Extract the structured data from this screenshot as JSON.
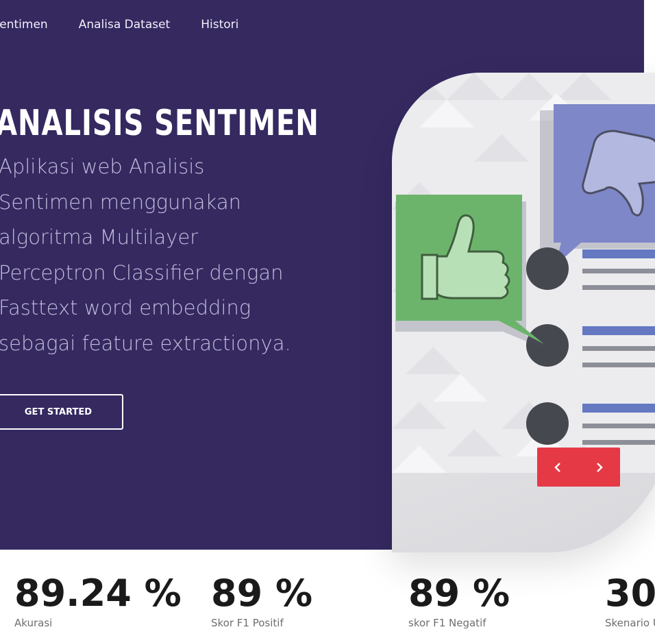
{
  "nav": {
    "items": [
      "limat Sentimen",
      "Analisa Dataset",
      "Histori"
    ]
  },
  "hero": {
    "title": "ANALISIS SENTIMEN",
    "description": "Aplikasi web Analisis Sentimen menggunakan algoritma Multilayer Perceptron Classifier dengan Fasttext word embedding sebagai feature extractionya.",
    "cta_label": "GET STARTED"
  },
  "carousel": {
    "prev_icon": "chevron-left-icon",
    "next_icon": "chevron-right-icon"
  },
  "stats": [
    {
      "value": "89.24 %",
      "label": "Akurasi"
    },
    {
      "value": "89 %",
      "label": "Skor F1 Positif"
    },
    {
      "value": "89 %",
      "label": "skor F1 Negatif"
    },
    {
      "value": "30",
      "label": "Skenario U"
    }
  ],
  "colors": {
    "hero_bg": "#352960",
    "accent": "#e53946",
    "positive": "#6cb46c",
    "negative": "#7e87c8"
  }
}
